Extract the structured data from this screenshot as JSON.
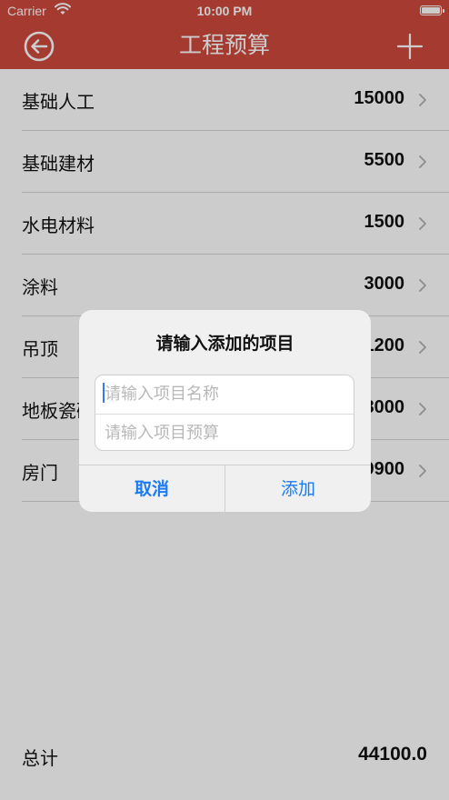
{
  "status_bar": {
    "carrier": "Carrier",
    "time": "10:00 PM"
  },
  "nav": {
    "title": "工程预算",
    "back_icon": "circle-arrow-left-icon",
    "add_icon": "plus-icon"
  },
  "colors": {
    "nav_bg": "#cf4a3c",
    "accent": "#1a7bf2"
  },
  "items": [
    {
      "name": "基础人工",
      "amount": "15000"
    },
    {
      "name": "基础建材",
      "amount": "5500"
    },
    {
      "name": "水电材料",
      "amount": "1500"
    },
    {
      "name": "涂料",
      "amount": "3000"
    },
    {
      "name": "吊顶",
      "amount": "1200"
    },
    {
      "name": "地板瓷砖",
      "amount": "8000"
    },
    {
      "name": "房门",
      "amount": "9900"
    }
  ],
  "footer": {
    "label": "总计",
    "total": "44100.0"
  },
  "dialog": {
    "title": "请输入添加的项目",
    "name_placeholder": "请输入项目名称",
    "budget_placeholder": "请输入项目预算",
    "cancel_label": "取消",
    "add_label": "添加"
  }
}
